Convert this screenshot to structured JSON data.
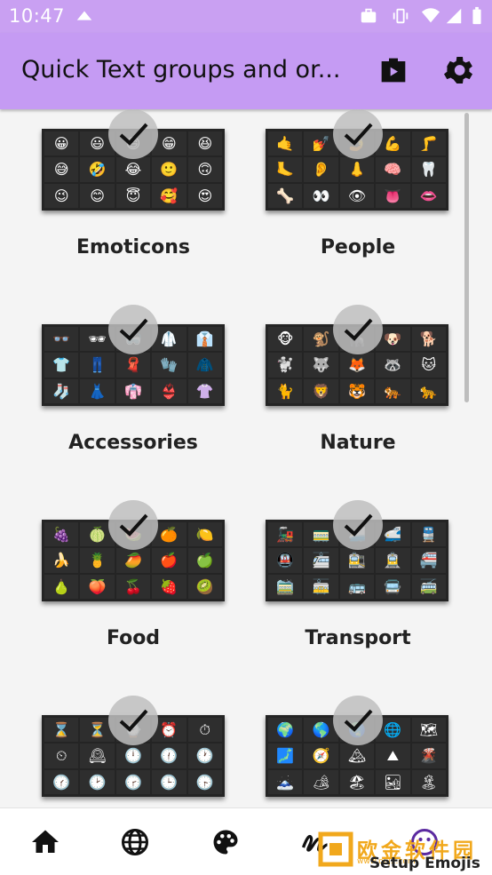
{
  "status_bar": {
    "time": "10:47",
    "icons": [
      "android-icon",
      "briefcase-icon",
      "vibrate-icon",
      "wifi-icon",
      "signal-icon",
      "battery-icon"
    ]
  },
  "app_bar": {
    "title": "Quick Text groups and or...",
    "actions": [
      "store-icon",
      "gear-icon"
    ]
  },
  "groups": [
    {
      "label": "Emoticons",
      "selected": true,
      "emojis": [
        "😀",
        "😃",
        "😄",
        "😁",
        "😆",
        "😅",
        "🤣",
        "😂",
        "🙂",
        "🙃",
        "😉",
        "😊",
        "😇",
        "🥰",
        "😍"
      ]
    },
    {
      "label": "People",
      "selected": true,
      "emojis": [
        "🤙",
        "💅",
        "🤳",
        "💪",
        "🦵",
        "🦶",
        "👂",
        "👃",
        "🧠",
        "🦷",
        "🦴",
        "👀",
        "👁",
        "👅",
        "👄"
      ]
    },
    {
      "label": "Accessories",
      "selected": true,
      "emojis": [
        "👓",
        "🕶",
        "🥽",
        "🥼",
        "👔",
        "👕",
        "👖",
        "🧣",
        "🧤",
        "🧥",
        "🧦",
        "👗",
        "👘",
        "👙",
        "👚"
      ]
    },
    {
      "label": "Nature",
      "selected": true,
      "emojis": [
        "🐵",
        "🐒",
        "🦍",
        "🐶",
        "🐕",
        "🐩",
        "🐺",
        "🦊",
        "🦝",
        "🐱",
        "🐈",
        "🦁",
        "🐯",
        "🐅",
        "🐆"
      ]
    },
    {
      "label": "Food",
      "selected": true,
      "emojis": [
        "🍇",
        "🍈",
        "🍉",
        "🍊",
        "🍋",
        "🍌",
        "🍍",
        "🥭",
        "🍎",
        "🍏",
        "🍐",
        "🍑",
        "🍒",
        "🍓",
        "🥝"
      ]
    },
    {
      "label": "Transport",
      "selected": true,
      "emojis": [
        "🚂",
        "🚃",
        "🚄",
        "🚅",
        "🚆",
        "🚇",
        "🚈",
        "🚉",
        "🚊",
        "🚝",
        "🚞",
        "🚋",
        "🚌",
        "🚍",
        "🚎"
      ]
    },
    {
      "label": "",
      "selected": true,
      "emojis": [
        "⌛",
        "⏳",
        "⌚",
        "⏰",
        "⏱",
        "⏲",
        "🕰",
        "🕛",
        "🕧",
        "🕐",
        "🕜",
        "🕑",
        "🕝",
        "🕒",
        "🕞"
      ]
    },
    {
      "label": "",
      "selected": true,
      "emojis": [
        "🌍",
        "🌎",
        "🌏",
        "🌐",
        "🗺",
        "🗾",
        "🧭",
        "🏔",
        "⛰",
        "🌋",
        "🗻",
        "🏕",
        "🏖",
        "🏜",
        "🏝"
      ]
    }
  ],
  "bottom_nav": [
    "home-icon",
    "globe-icon",
    "palette-icon",
    "handwriting-icon",
    "emoji-face-icon"
  ],
  "watermark": {
    "text": "欧金软件园",
    "url": "www.ouj...com"
  },
  "setup_label": "Setup Emojis",
  "colors": {
    "appbar": "#c59bf3",
    "statusbar": "#c9a0f2",
    "card": "#242424",
    "accent_watermark": "#f1a81c"
  }
}
